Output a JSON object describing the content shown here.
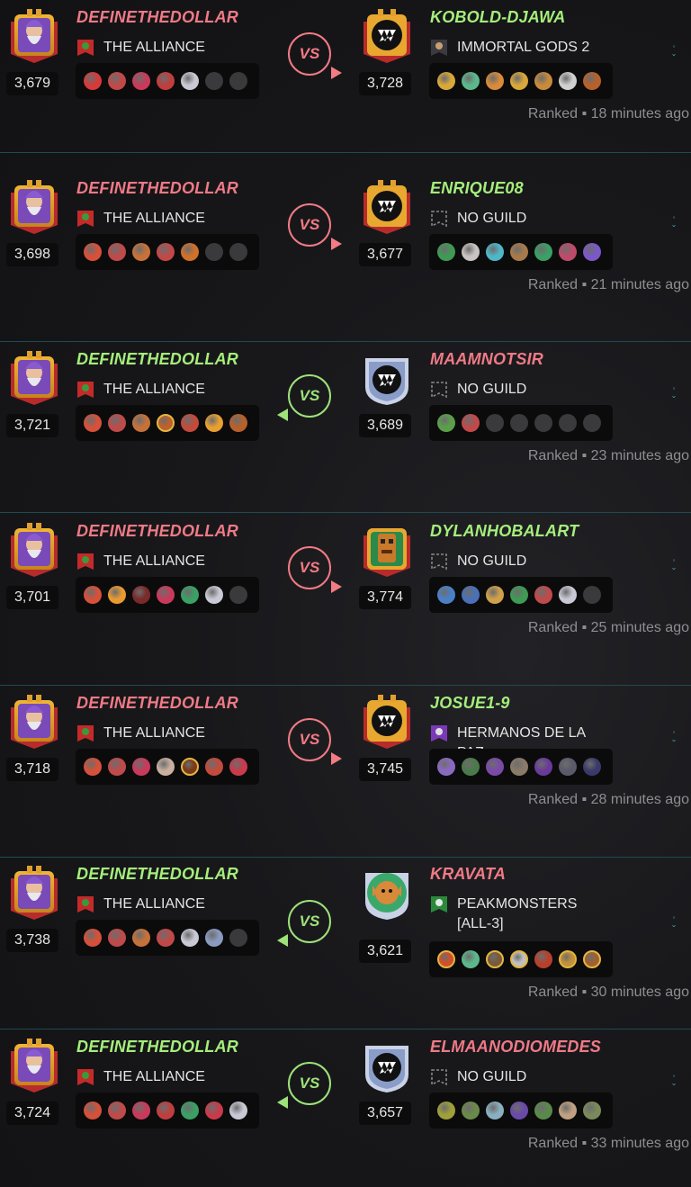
{
  "colors": {
    "win": "#a5ee7b",
    "lose": "#ef7a86",
    "divider": "#1f4a52"
  },
  "battles": [
    {
      "left": {
        "name": "DEFINETHEDOLLAR",
        "result": "lose",
        "avatar": "wizard-avatar",
        "rating": "3,679",
        "guild": "THE ALLIANCE",
        "guild_icon": "alliance-banner-icon",
        "cards": [
          "#d63a3a",
          "#c24848",
          "#c93a5a",
          "#c03e3e",
          "#c9c9d6",
          "empty",
          "empty"
        ]
      },
      "right": {
        "name": "KOBOLD-DJAWA",
        "result": "win",
        "avatar": "fanged-monster-avatar",
        "rating": "3,728",
        "guild": "IMMORTAL GODS 2",
        "guild_icon": "immortal-gods-banner-icon",
        "cards": [
          "#d9a83a",
          "#5cb88c",
          "#d98a3a",
          "#d9a83a",
          "#c98a3a",
          "#d0d0d0",
          "#b8602a"
        ]
      },
      "vs": "VS",
      "vs_color": "red",
      "arrow": "right",
      "meta": "Ranked ▪ 18 minutes ago"
    },
    {
      "left": {
        "name": "DEFINETHEDOLLAR",
        "result": "lose",
        "avatar": "wizard-avatar",
        "rating": "3,698",
        "guild": "THE ALLIANCE",
        "guild_icon": "alliance-banner-icon",
        "cards": [
          "#d6503a",
          "#c04a4a",
          "#c7713a",
          "#c24848",
          "#d0702a",
          "empty",
          "empty"
        ]
      },
      "right": {
        "name": "ENRIQUE08",
        "result": "win",
        "avatar": "fanged-monster-avatar",
        "rating": "3,677",
        "guild": "NO GUILD",
        "guild_icon": "no-guild-icon",
        "cards": [
          "#3e9a54",
          "#c9c3c3",
          "#4fb6c8",
          "#a87a4a",
          "#3aa064",
          "#c04a6a",
          "#7a58c8"
        ]
      },
      "vs": "VS",
      "vs_color": "red",
      "arrow": "right",
      "meta": "Ranked ▪ 21 minutes ago"
    },
    {
      "left": {
        "name": "DEFINETHEDOLLAR",
        "result": "win",
        "avatar": "wizard-avatar",
        "rating": "3,721",
        "guild": "THE ALLIANCE",
        "guild_icon": "alliance-banner-icon",
        "cards": [
          "#d6503a",
          "#c04a4a",
          "#c7713a",
          "gold:#c0602a",
          "#c44a3a",
          "#e8a030",
          "#b8602a"
        ]
      },
      "right": {
        "name": "MAAMNOTSIR",
        "result": "lose",
        "avatar": "silver-monster-avatar",
        "rating": "3,689",
        "guild": "NO GUILD",
        "guild_icon": "no-guild-icon",
        "cards": [
          "#5aa04a",
          "#c04a4a",
          "empty",
          "empty",
          "empty",
          "empty",
          "empty"
        ]
      },
      "vs": "VS",
      "vs_color": "green",
      "arrow": "left",
      "meta": "Ranked ▪ 23 minutes ago"
    },
    {
      "left": {
        "name": "DEFINETHEDOLLAR",
        "result": "lose",
        "avatar": "wizard-avatar",
        "rating": "3,701",
        "guild": "THE ALLIANCE",
        "guild_icon": "alliance-banner-icon",
        "cards": [
          "#d6503a",
          "#e89a30",
          "#7a2a2a",
          "#c93a5a",
          "#3aa064",
          "#c9c9d6",
          "empty"
        ]
      },
      "right": {
        "name": "DYLANHOBALART",
        "result": "win",
        "avatar": "tiki-mask-avatar",
        "rating": "3,774",
        "guild": "NO GUILD",
        "guild_icon": "no-guild-icon",
        "cards": [
          "#4a80c8",
          "#4a70b8",
          "#d0a04a",
          "#3e9a54",
          "#c04a4a",
          "#c9c9d6",
          "empty"
        ]
      },
      "vs": "VS",
      "vs_color": "red",
      "arrow": "right",
      "meta": "Ranked ▪ 25 minutes ago"
    },
    {
      "left": {
        "name": "DEFINETHEDOLLAR",
        "result": "lose",
        "avatar": "wizard-avatar",
        "rating": "3,718",
        "guild": "THE ALLIANCE",
        "guild_icon": "alliance-banner-icon",
        "cards": [
          "#d6503a",
          "#c04a4a",
          "#c93a5a",
          "#c9b0a0",
          "gold:#7a3a1a",
          "#c44a3a",
          "#c93a4a"
        ]
      },
      "right": {
        "name": "JOSUE1-9",
        "result": "win",
        "avatar": "fanged-monster-avatar",
        "rating": "3,745",
        "guild": "HERMANOS DE LA PAZ",
        "guild_icon": "hermanos-banner-icon",
        "cards": [
          "#8a6ac0",
          "#4a7a4a",
          "#7a4aa8",
          "#8a7a6a",
          "#6a3a9a",
          "#5a5a6a",
          "#3a3a6a"
        ]
      },
      "vs": "VS",
      "vs_color": "red",
      "arrow": "right",
      "meta": "Ranked ▪ 28 minutes ago"
    },
    {
      "left": {
        "name": "DEFINETHEDOLLAR",
        "result": "win",
        "avatar": "wizard-avatar",
        "rating": "3,738",
        "guild": "THE ALLIANCE",
        "guild_icon": "alliance-banner-icon",
        "cards": [
          "#d6503a",
          "#c04a4a",
          "#c7713a",
          "#c24848",
          "#c9c9d6",
          "#8a9ac0",
          "empty"
        ]
      },
      "right": {
        "name": "KRAVATA",
        "result": "lose",
        "avatar": "goblin-avatar",
        "rating": "3,621",
        "guild": "PEAKMONSTERS [ALL-3]",
        "guild_icon": "peakmonsters-banner-icon",
        "cards": [
          "gold:#d0502a",
          "#5cb88c",
          "gold:#7a5a3a",
          "gold:#c0c0c0",
          "#b8402a",
          "gold:#c0903a",
          "gold:#a06030"
        ]
      },
      "vs": "VS",
      "vs_color": "green",
      "arrow": "left",
      "meta": "Ranked ▪ 30 minutes ago"
    },
    {
      "left": {
        "name": "DEFINETHEDOLLAR",
        "result": "win",
        "avatar": "wizard-avatar",
        "rating": "3,724",
        "guild": "THE ALLIANCE",
        "guild_icon": "alliance-banner-icon",
        "cards": [
          "#d6503a",
          "#c04a4a",
          "#c93a5a",
          "#c03e3e",
          "#3aa064",
          "#c93a4a",
          "#c9c9d6"
        ]
      },
      "right": {
        "name": "ELMAANODIOMEDES",
        "result": "lose",
        "avatar": "silver-monster-avatar",
        "rating": "3,657",
        "guild": "NO GUILD",
        "guild_icon": "no-guild-icon",
        "cards": [
          "#a0a03a",
          "#6a8a4a",
          "#8ab0c0",
          "#6a4aa8",
          "#5a8a4a",
          "#c0a080",
          "#7a8a5a"
        ]
      },
      "vs": "VS",
      "vs_color": "green",
      "arrow": "left",
      "meta": "Ranked ▪ 33 minutes ago"
    }
  ]
}
